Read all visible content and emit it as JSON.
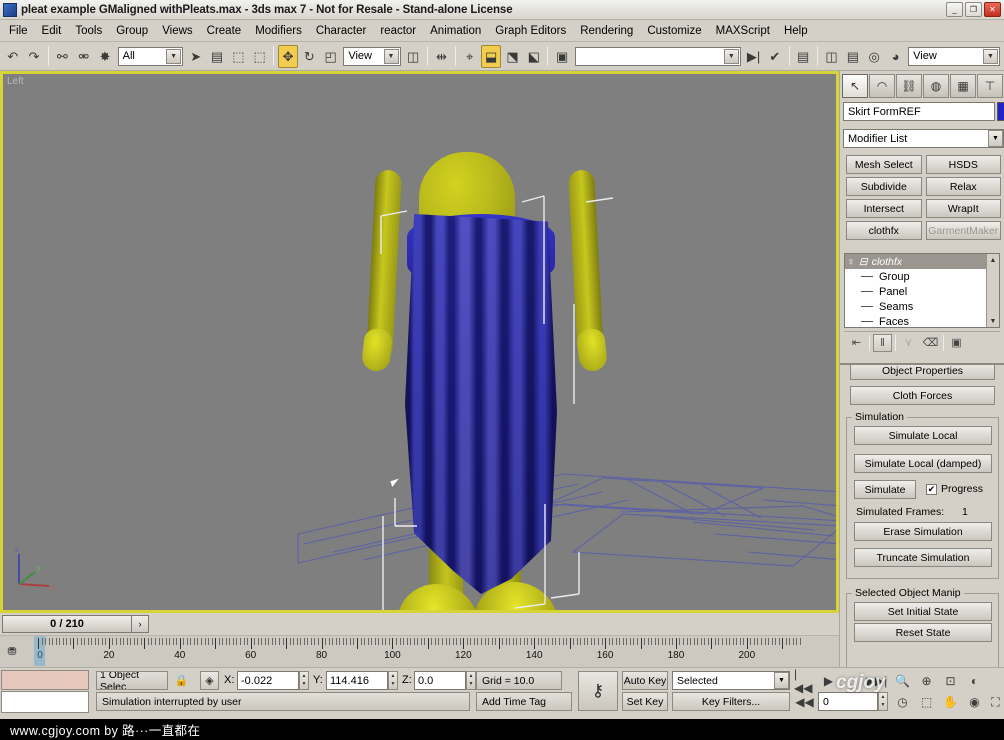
{
  "window": {
    "title": "pleat example GMaligned withPleats.max - 3ds max 7  - Not for Resale - Stand-alone License",
    "minimize": "_",
    "maximize": "❐",
    "close": "✕"
  },
  "menu": {
    "items": [
      "File",
      "Edit",
      "Tools",
      "Group",
      "Views",
      "Create",
      "Modifiers",
      "Character",
      "reactor",
      "Animation",
      "Graph Editors",
      "Rendering",
      "Customize",
      "MAXScript",
      "Help"
    ]
  },
  "toolbar": {
    "undo_icon": "↶",
    "redo_icon": "↷",
    "select_link_icon": "⚯",
    "unlink_icon": "⚮",
    "bind_space_warp_icon": "✸",
    "selection_filter": "All",
    "select_object_icon": "➤",
    "select_by_name_icon": "▤",
    "select_region_icon": "⬚",
    "select_region2_icon": "⬚",
    "select_move_icon": "✥",
    "select_rotate_icon": "↻",
    "select_scale_icon": "◰",
    "reference_coord_system": "View",
    "use_center_icon": "◫",
    "mirror_icon": "⇹",
    "align_icon": "⌖",
    "array_icon": "⬓",
    "snapshot_icon": "⬔",
    "spacing_icon": "⬕",
    "named_selection_icon": "▣",
    "named_selection_sets": "",
    "curve_editor_icon": "▶|",
    "schematic_icon": "✔",
    "layer_icon": "▤",
    "material_editor_icon": "◫",
    "render_scene_icon": "▤",
    "render_type_icon": "◎",
    "quick_render_icon": "◕",
    "viewport_combo": "View"
  },
  "viewport": {
    "label": "Left",
    "axis_x": "x",
    "axis_y": "y",
    "axis_z": "z"
  },
  "timeslider": {
    "frame_display": "0 / 210",
    "next_frame": "›",
    "key_icon": "⛃"
  },
  "ruler": {
    "ticks": [
      0,
      20,
      40,
      60,
      80,
      100,
      120,
      140,
      160,
      180,
      200
    ],
    "min": 0,
    "max": 215
  },
  "command_panel": {
    "tabs": [
      {
        "name": "create",
        "icon": "↖",
        "selected": true
      },
      {
        "name": "modify",
        "icon": "◠",
        "selected": false
      },
      {
        "name": "hierarchy",
        "icon": "⛓",
        "selected": false
      },
      {
        "name": "motion",
        "icon": "◍",
        "selected": false
      },
      {
        "name": "display",
        "icon": "▦",
        "selected": false
      },
      {
        "name": "utilities",
        "icon": "⊤",
        "selected": false
      }
    ],
    "object_name": "Skirt FormREF",
    "object_color": "#2222c8",
    "modifier_list": "Modifier List",
    "modifier_buttons": [
      {
        "label": "Mesh Select",
        "dim": false
      },
      {
        "label": "HSDS",
        "dim": false
      },
      {
        "label": "Subdivide",
        "dim": false
      },
      {
        "label": "Relax",
        "dim": false
      },
      {
        "label": "Intersect",
        "dim": false
      },
      {
        "label": "WrapIt",
        "dim": false
      },
      {
        "label": "clothfx",
        "dim": false
      },
      {
        "label": "GarmentMaker",
        "dim": true
      }
    ],
    "stack": {
      "root": "clothfx",
      "bulb_icon": "♀",
      "expand_icon": "⊟",
      "children": [
        "Group",
        "Panel",
        "Seams",
        "Faces"
      ],
      "scroll_up": "▲",
      "scroll_down": "▼"
    },
    "stack_tools": [
      {
        "name": "pin-stack",
        "icon": "⇤",
        "framed": false,
        "dim": false
      },
      {
        "name": "show-end-result",
        "icon": "‖",
        "framed": true,
        "dim": false
      },
      {
        "name": "make-unique",
        "icon": "⋎",
        "framed": false,
        "dim": true
      },
      {
        "name": "remove-modifier",
        "icon": "⌫",
        "framed": false,
        "dim": false
      },
      {
        "name": "configure-sets",
        "icon": "▣",
        "framed": false,
        "dim": false
      }
    ]
  },
  "rollout": {
    "object_properties": "Object Properties",
    "cloth_forces": "Cloth Forces",
    "simulation_group": "Simulation",
    "simulate_local": "Simulate Local",
    "simulate_local_damped": "Simulate Local (damped)",
    "simulate": "Simulate",
    "progress_label": "Progress",
    "progress_checked": "✔",
    "simulated_frames_label": "Simulated Frames:",
    "simulated_frames_value": "1",
    "erase_simulation": "Erase Simulation",
    "truncate_simulation": "Truncate Simulation",
    "selected_object_manip_group": "Selected Object Manip",
    "set_initial_state": "Set Initial State",
    "reset_state": "Reset State"
  },
  "status": {
    "selection_info": "1 Object Selec",
    "lock_icon": "🔒",
    "absolute_mode_icon": "◈",
    "x_label": "X:",
    "x_value": "-0.022",
    "y_label": "Y:",
    "y_value": "114.416",
    "z_label": "Z:",
    "z_value": "0.0",
    "grid_label": "Grid = 10.0",
    "add_time_tag": "Add Time Tag",
    "prompt": "Simulation interrupted by user",
    "key_mode_icon": "⚷",
    "auto_key": "Auto Key",
    "set_key": "Set Key",
    "key_filters": "Key Filters...",
    "selection_level": "Selected",
    "go_to_start_icon": "|◀◀",
    "previous_frame_icon": "◀◀",
    "play_icon": "▶",
    "next_frame_icon": "▶▶|",
    "current_frame": "0",
    "time_config_icon": "◷",
    "zoom_icon": "🔍",
    "zoom_all_icon": "⊕",
    "zoom_extents_icon": "⊡",
    "zoom_region_icon": "⬚",
    "pan_icon": "✋",
    "arc_rotate_icon": "◉",
    "maximize_viewport_icon": "⛶",
    "field_of_view_icon": "◐"
  },
  "watermark": {
    "text": "www.cgjoy.com by 路···一直都在",
    "viewport_logo": "cgjoy"
  }
}
